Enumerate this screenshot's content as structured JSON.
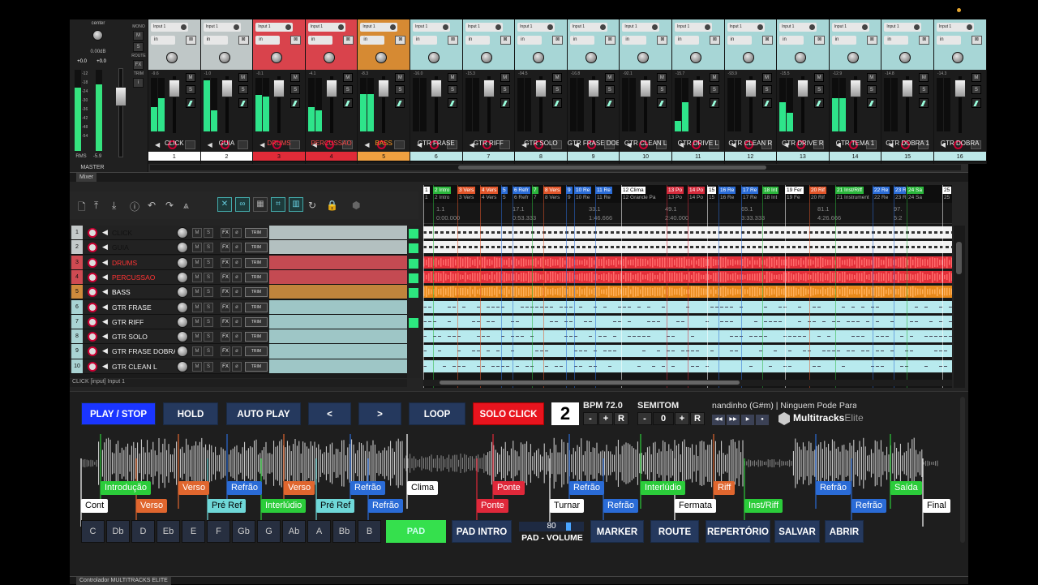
{
  "master": {
    "pan_label": "center",
    "db_top": "0.00dB",
    "peak_l": "+0.0",
    "peak_r": "+0.0",
    "scale": [
      "-12",
      "-18",
      "-24",
      "-30",
      "-36",
      "-42",
      "-48",
      "-54"
    ],
    "rms_label": "RMS",
    "rms_value": "-5.9",
    "name": "MASTER",
    "side_buttons": [
      "MONO",
      "M",
      "S",
      "ROUTE",
      "FX",
      "TRIM",
      "i"
    ]
  },
  "mixer_strips": [
    {
      "input": "Input 1",
      "db": "-9.6",
      "name": "CLICK",
      "num": "1",
      "color": "#bfc7c7",
      "name_color": "#eeeeee",
      "num_bg": "#ffffff",
      "vu": [
        0.45,
        0.62
      ]
    },
    {
      "input": "Input 1",
      "db": "-1.0",
      "name": "GUIA",
      "num": "2",
      "color": "#bfc7c7",
      "name_color": "#eeeeee",
      "num_bg": "#ffffff",
      "vu": [
        0.95,
        0.4
      ]
    },
    {
      "input": "Input 1",
      "db": "-0.1",
      "name": "DRUMS",
      "num": "3",
      "color": "#d9434c",
      "name_color": "#ff4a4a",
      "num_bg": "#e02b38",
      "vu": [
        0.68,
        0.65
      ]
    },
    {
      "input": "Input 1",
      "db": "-4.1",
      "name": "PERCUSSAO",
      "num": "4",
      "color": "#d9434c",
      "name_color": "#ff4a4a",
      "num_bg": "#e02b38",
      "vu": [
        0.45,
        0.4
      ]
    },
    {
      "input": "Input 1",
      "db": "-8.3",
      "name": "BASS",
      "num": "5",
      "color": "#d68a33",
      "name_color": "#ff9a22",
      "num_bg": "#f0a040",
      "vu": [
        0.7,
        0.7
      ]
    },
    {
      "input": "Input 1",
      "db": "-16.0",
      "name": "GTR FRASE",
      "num": "6",
      "color": "#a7d6d6",
      "name_color": "#eeeeee",
      "num_bg": "#bde8e8",
      "vu": [
        0,
        0
      ]
    },
    {
      "input": "Input 1",
      "db": "-15.3",
      "name": "GTR RIFF",
      "num": "7",
      "color": "#a7d6d6",
      "name_color": "#eeeeee",
      "num_bg": "#bde8e8",
      "vu": [
        0,
        0
      ]
    },
    {
      "input": "Input 1",
      "db": "-94.5",
      "name": "GTR SOLO",
      "num": "8",
      "color": "#a7d6d6",
      "name_color": "#eeeeee",
      "num_bg": "#bde8e8",
      "vu": [
        0,
        0
      ]
    },
    {
      "input": "Input 1",
      "db": "-16.8",
      "name": "GTR FRASE DOBRA",
      "num": "9",
      "color": "#a7d6d6",
      "name_color": "#eeeeee",
      "num_bg": "#bde8e8",
      "vu": [
        0,
        0
      ]
    },
    {
      "input": "Input 1",
      "db": "-92.1",
      "name": "GTR CLEAN L",
      "num": "10",
      "color": "#a7d6d6",
      "name_color": "#eeeeee",
      "num_bg": "#bde8e8",
      "vu": [
        0,
        0
      ]
    },
    {
      "input": "Input 1",
      "db": "-15.7",
      "name": "GTR DRIVE L",
      "num": "11",
      "color": "#a7d6d6",
      "name_color": "#eeeeee",
      "num_bg": "#bde8e8",
      "vu": [
        0.2,
        0.55
      ]
    },
    {
      "input": "Input 1",
      "db": "-93.9",
      "name": "GTR CLEAN R",
      "num": "12",
      "color": "#a7d6d6",
      "name_color": "#eeeeee",
      "num_bg": "#bde8e8",
      "vu": [
        0,
        0
      ]
    },
    {
      "input": "Input 1",
      "db": "-15.5",
      "name": "GTR DRIVE R",
      "num": "13",
      "color": "#a7d6d6",
      "name_color": "#eeeeee",
      "num_bg": "#bde8e8",
      "vu": [
        0.55,
        0.35
      ]
    },
    {
      "input": "Input 1",
      "db": "-12.9",
      "name": "GTR TEMA 1",
      "num": "14",
      "color": "#a7d6d6",
      "name_color": "#eeeeee",
      "num_bg": "#bde8e8",
      "vu": [
        0.62,
        0.62
      ]
    },
    {
      "input": "Input 1",
      "db": "-14.8",
      "name": "GTR DOBRA 1",
      "num": "15",
      "color": "#a7d6d6",
      "name_color": "#eeeeee",
      "num_bg": "#bde8e8",
      "vu": [
        0,
        0
      ]
    },
    {
      "input": "Input 1",
      "db": "-14.3",
      "name": "GTR DOBRA",
      "num": "16",
      "color": "#a7d6d6",
      "name_color": "#eeeeee",
      "num_bg": "#bde8e8",
      "vu": [
        0,
        0
      ]
    }
  ],
  "strip_labels": {
    "in": "in",
    "m": "M",
    "s": "S"
  },
  "mixer_tab": "Mixer",
  "tracks": [
    {
      "num": "1",
      "name": "CLICK",
      "color": "#c4c9c9",
      "text": "#111111",
      "ext": "#b3c0c0"
    },
    {
      "num": "2",
      "name": "GUIA",
      "color": "#c4c9c9",
      "text": "#111111",
      "ext": "#b3c0c0"
    },
    {
      "num": "3",
      "name": "DRUMS",
      "color": "#cf4a52",
      "text": "#ff3333",
      "ext": "#c44a52"
    },
    {
      "num": "4",
      "name": "PERCUSSAO",
      "color": "#cf4a52",
      "text": "#ff3333",
      "ext": "#c44a52"
    },
    {
      "num": "5",
      "name": "BASS",
      "color": "#cf8a3c",
      "text": "#ffffff",
      "ext": "#c0843c"
    },
    {
      "num": "6",
      "name": "GTR FRASE",
      "color": "#a9d3d3",
      "text": "#eeeeee",
      "ext": "#9ec6c6"
    },
    {
      "num": "7",
      "name": "GTR RIFF",
      "color": "#a9d3d3",
      "text": "#eeeeee",
      "ext": "#9ec6c6"
    },
    {
      "num": "8",
      "name": "GTR SOLO",
      "color": "#a9d3d3",
      "text": "#eeeeee",
      "ext": "#9ec6c6"
    },
    {
      "num": "9",
      "name": "GTR FRASE DOBRA",
      "color": "#a9d3d3",
      "text": "#eeeeee",
      "ext": "#9ec6c6"
    },
    {
      "num": "10",
      "name": "GTR CLEAN L",
      "color": "#a9d3d3",
      "text": "#eeeeee",
      "ext": "#9ec6c6"
    }
  ],
  "track_buttons": {
    "m": "M",
    "s": "S",
    "fx": "FX",
    "trim": "TRIM"
  },
  "tracklist_status": "CLICK [input] Input 1",
  "markers_row1": [
    {
      "t": "1",
      "c": "#ffffff"
    },
    {
      "t": "2 Intro",
      "c": "#2bb53c"
    },
    {
      "t": "3 Vers",
      "c": "#e0552a"
    },
    {
      "t": "4 Vers",
      "c": "#e0552a"
    },
    {
      "t": "5",
      "c": "#2b6cd6"
    },
    {
      "t": "6 Refr",
      "c": "#2b6cd6"
    },
    {
      "t": "7",
      "c": "#2bb53c"
    },
    {
      "t": "8 Vers",
      "c": "#e0552a"
    },
    {
      "t": "9",
      "c": "#2b6cd6"
    },
    {
      "t": "10 Re",
      "c": "#2b6cd6"
    },
    {
      "t": "11 Re",
      "c": "#2b6cd6"
    },
    {
      "t": "12 Clima",
      "c": "#ffffff"
    },
    {
      "t": "13 Po",
      "c": "#d42b3c"
    },
    {
      "t": "14 Po",
      "c": "#d42b3c"
    },
    {
      "t": "15",
      "c": "#ffffff"
    },
    {
      "t": "16 Re",
      "c": "#2b6cd6"
    },
    {
      "t": "17 Re",
      "c": "#2b6cd6"
    },
    {
      "t": "18 Int",
      "c": "#2bb53c"
    },
    {
      "t": "19 Fer",
      "c": "#ffffff"
    },
    {
      "t": "20 Rif",
      "c": "#e0552a"
    },
    {
      "t": "21 Inst/Riff",
      "c": "#2bb53c"
    },
    {
      "t": "22 Re",
      "c": "#2b6cd6"
    },
    {
      "t": "23 Re",
      "c": "#2b6cd6"
    },
    {
      "t": "24 Sa",
      "c": "#2bb53c"
    },
    {
      "t": "25",
      "c": "#ffffff"
    }
  ],
  "markers_row2": [
    {
      "t": "1",
      "c": "#ffffff"
    },
    {
      "t": "2 Intro",
      "c": "#2bb53c"
    },
    {
      "t": "3 Vers",
      "c": "#e0552a"
    },
    {
      "t": "4 Vers",
      "c": "#e0552a"
    },
    {
      "t": "5",
      "c": "#2b6cd6"
    },
    {
      "t": "6 Refr",
      "c": "#2b6cd6"
    },
    {
      "t": "7",
      "c": "#2bb53c"
    },
    {
      "t": "8 Vers",
      "c": "#e0552a"
    },
    {
      "t": "9",
      "c": "#2b6cd6"
    },
    {
      "t": "10 Re",
      "c": "#2b6cd6"
    },
    {
      "t": "11 Re",
      "c": "#2b6cd6"
    },
    {
      "t": "12 Grande Pa",
      "c": "#ffffff"
    },
    {
      "t": "13 Po",
      "c": "#d42b3c"
    },
    {
      "t": "14 Po",
      "c": "#d42b3c"
    },
    {
      "t": "15",
      "c": "#ffffff"
    },
    {
      "t": "16 Re",
      "c": "#2b6cd6"
    },
    {
      "t": "17 Re",
      "c": "#2b6cd6"
    },
    {
      "t": "18 Int",
      "c": "#2bb53c"
    },
    {
      "t": "19 Fe",
      "c": "#ffffff"
    },
    {
      "t": "20 Rif",
      "c": "#e0552a"
    },
    {
      "t": "21 Instrument",
      "c": "#2bb53c"
    },
    {
      "t": "22 Re",
      "c": "#2b6cd6"
    },
    {
      "t": "23 Re",
      "c": "#2b6cd6"
    },
    {
      "t": "24 Sa",
      "c": "#2bb53c"
    },
    {
      "t": "25 Fin",
      "c": "#ffffff"
    }
  ],
  "ruler": [
    {
      "bar": "1.1",
      "time": "0:00.000"
    },
    {
      "bar": "17.1",
      "time": "0:53.333"
    },
    {
      "bar": "33.1",
      "time": "1:46.666"
    },
    {
      "bar": "49.1",
      "time": "2:40.000"
    },
    {
      "bar": "65.1",
      "time": "3:33.333"
    },
    {
      "bar": "81.1",
      "time": "4:26.666"
    },
    {
      "bar": "97.",
      "time": "5:2"
    }
  ],
  "controls": {
    "play_stop": "PLAY / STOP",
    "hold": "HOLD",
    "auto_play": "AUTO PLAY",
    "prev": "<",
    "next": ">",
    "loop": "LOOP",
    "solo_click": "SOLO CLICK",
    "count": "2",
    "bpm_label": "BPM 72.0",
    "semitom_label": "SEMITOM",
    "semitom_value": "0",
    "minus": "-",
    "plus": "+",
    "reset": "R",
    "song": "nandinho (G#m)  |  Ninguem Pode Parar",
    "logo_main": "Multitracks",
    "logo_sub": "Elite",
    "transport": [
      "◀◀",
      "▶▶",
      "▶",
      "●"
    ]
  },
  "wave_labels_top": [
    {
      "t": "Introdução",
      "c": "#2bcc3a",
      "k": false
    },
    {
      "t": "Verso",
      "c": "#e0662e",
      "k": false
    },
    {
      "t": "Refrão",
      "c": "#2a6bd6",
      "k": false
    },
    {
      "t": "Verso",
      "c": "#e0662e",
      "k": false
    },
    {
      "t": "Refrão",
      "c": "#2a6bd6",
      "k": false
    },
    {
      "t": "Clima",
      "c": "#ffffff",
      "k": true
    },
    {
      "t": "Ponte",
      "c": "#e0283a",
      "k": false
    },
    {
      "t": "Refrão",
      "c": "#2a6bd6",
      "k": false
    },
    {
      "t": "Interlúdio",
      "c": "#2bcc3a",
      "k": false
    },
    {
      "t": "Riff",
      "c": "#e0662e",
      "k": false
    },
    {
      "t": "Refrão",
      "c": "#2a6bd6",
      "k": false
    },
    {
      "t": "Saída",
      "c": "#2bcc3a",
      "k": false
    }
  ],
  "wave_labels_bottom": [
    {
      "t": "Cont",
      "c": "#ffffff",
      "k": true
    },
    {
      "t": "Verso",
      "c": "#e0662e",
      "k": false
    },
    {
      "t": "Pré Ref",
      "c": "#6fd8d8",
      "k": true
    },
    {
      "t": "Interlúdio",
      "c": "#2bcc3a",
      "k": false
    },
    {
      "t": "Pré Ref",
      "c": "#6fd8d8",
      "k": true
    },
    {
      "t": "Refrão",
      "c": "#2a6bd6",
      "k": false
    },
    {
      "t": "Ponte",
      "c": "#e0283a",
      "k": false
    },
    {
      "t": "Turnar",
      "c": "#ffffff",
      "k": true
    },
    {
      "t": "Refrão",
      "c": "#2a6bd6",
      "k": false
    },
    {
      "t": "Fermata",
      "c": "#ffffff",
      "k": true
    },
    {
      "t": "Inst/Riff",
      "c": "#2bcc3a",
      "k": false
    },
    {
      "t": "Refrão",
      "c": "#2a6bd6",
      "k": false
    },
    {
      "t": "Final",
      "c": "#ffffff",
      "k": true
    }
  ],
  "keys": [
    "C",
    "Db",
    "D",
    "Eb",
    "E",
    "F",
    "Gb",
    "G",
    "Ab",
    "A",
    "Bb",
    "B"
  ],
  "bottom": {
    "pad": "PAD",
    "pad_intro": "PAD INTRO",
    "volume": "80",
    "volume_label": "PAD - VOLUME",
    "volume_level": 0.8,
    "marker": "MARKER",
    "route": "ROUTE",
    "repertorio": "REPERTÓRIO",
    "salvar": "SALVAR",
    "abrir": "ABRIR"
  },
  "ctrl_tab": "Controlador MULTITRACKS ELITE",
  "colors": {
    "accent_blue": "#1a35ff",
    "solo_red": "#e8141e",
    "pad_green": "#35e04d",
    "button_bg": "#25395e"
  }
}
